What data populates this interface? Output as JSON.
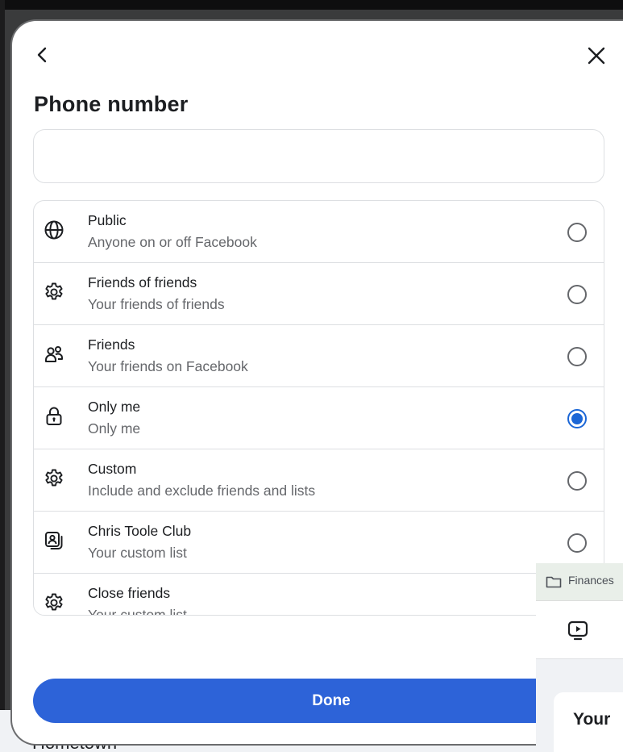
{
  "background": {
    "hometown_label": "Hometown"
  },
  "dialog": {
    "title": "Phone number",
    "phone_input": {
      "value": "",
      "placeholder": ""
    },
    "options": [
      {
        "label": "Public",
        "description": "Anyone on or off Facebook",
        "icon": "globe-icon",
        "selected": false
      },
      {
        "label": "Friends of friends",
        "description": "Your friends of friends",
        "icon": "gear-icon",
        "selected": false
      },
      {
        "label": "Friends",
        "description": "Your friends on Facebook",
        "icon": "people-icon",
        "selected": false
      },
      {
        "label": "Only me",
        "description": "Only me",
        "icon": "lock-icon",
        "selected": true
      },
      {
        "label": "Custom",
        "description": "Include and exclude friends and lists",
        "icon": "gear-icon",
        "selected": false
      },
      {
        "label": "Chris Toole Club",
        "description": "Your custom list",
        "icon": "contact-list-icon",
        "selected": false
      },
      {
        "label": "Close friends",
        "description": "Your custom list",
        "icon": "gear-icon",
        "selected": false
      }
    ],
    "done_label": "Done"
  },
  "side_panel": {
    "folder_label": "Finances",
    "card_title": "Your"
  },
  "colors": {
    "accent": "#1b66d6",
    "done_button": "#2d63d8",
    "text_primary": "#1c1e21",
    "text_secondary": "#65676b",
    "border": "#dddfe2"
  }
}
